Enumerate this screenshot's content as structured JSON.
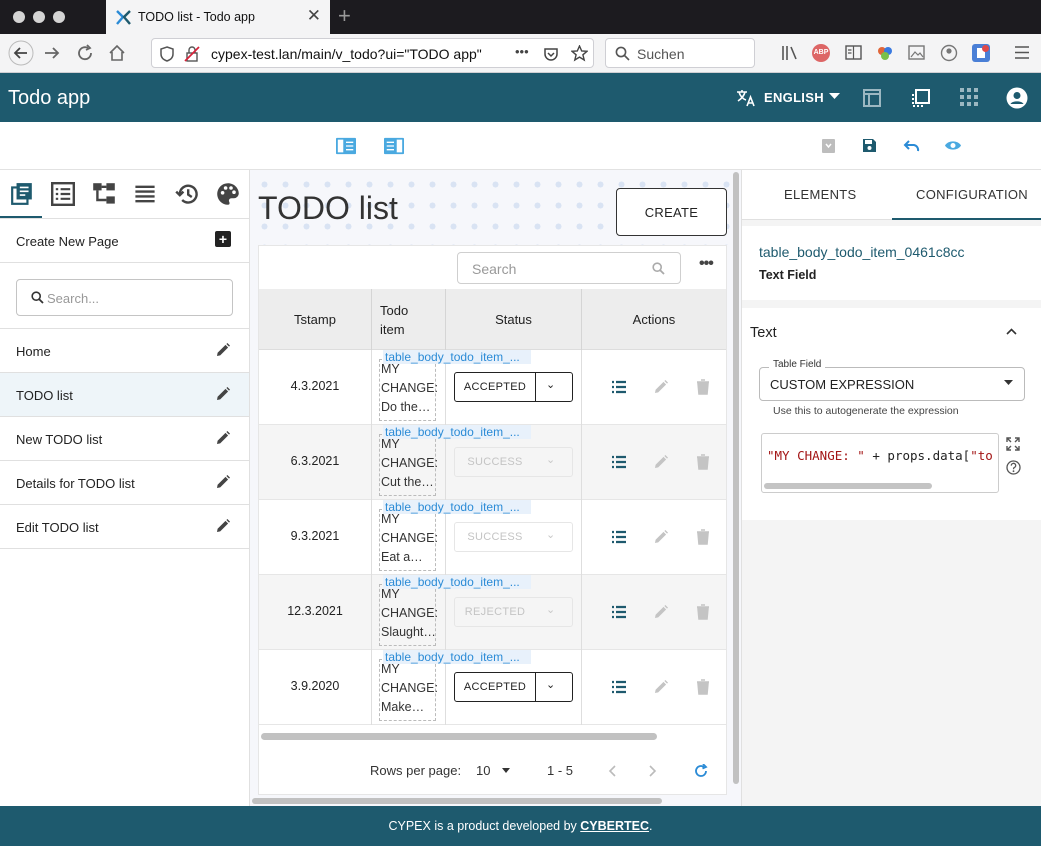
{
  "browser": {
    "tab_title": "TODO list - Todo app",
    "url": "cypex-test.lan/main/v_todo?ui=\"TODO app\"",
    "search_placeholder": "Suchen",
    "url_more": "•••"
  },
  "app": {
    "title": "Todo app",
    "language": "ENGLISH"
  },
  "sidebar": {
    "create_new_page": "Create New Page",
    "search_placeholder": "Search...",
    "pages": [
      {
        "label": "Home"
      },
      {
        "label": "TODO list"
      },
      {
        "label": "New TODO list"
      },
      {
        "label": "Details for TODO list"
      },
      {
        "label": "Edit TODO list"
      }
    ]
  },
  "main": {
    "page_title": "TODO list",
    "create_label": "CREATE",
    "table": {
      "search_placeholder": "Search",
      "columns": [
        "Tstamp",
        "Todo item",
        "Status",
        "Actions"
      ],
      "column_todo_line1": "Todo",
      "column_todo_line2": "item",
      "element_tag": "table_body_todo_item_...",
      "rows": [
        {
          "tstamp": "4.3.2021",
          "todo_l1": "MY",
          "todo_l2": "CHANGE:",
          "todo_l3": "Do the…",
          "status": "ACCEPTED"
        },
        {
          "tstamp": "6.3.2021",
          "todo_l1": "MY",
          "todo_l2": "CHANGE:",
          "todo_l3": "Cut the…",
          "status": "SUCCESS"
        },
        {
          "tstamp": "9.3.2021",
          "todo_l1": "MY",
          "todo_l2": "CHANGE:",
          "todo_l3": "Eat a…",
          "status": "SUCCESS"
        },
        {
          "tstamp": "12.3.2021",
          "todo_l1": "MY",
          "todo_l2": "CHANGE:",
          "todo_l3": "Slaught…",
          "status": "REJECTED"
        },
        {
          "tstamp": "3.9.2020",
          "todo_l1": "MY",
          "todo_l2": "CHANGE:",
          "todo_l3": "Make…",
          "status": "ACCEPTED"
        }
      ],
      "rows_per_page_label": "Rows per page:",
      "rows_per_page": "10",
      "page_range": "1 - 5"
    }
  },
  "right_panel": {
    "tabs": [
      "ELEMENTS",
      "CONFIGURATION"
    ],
    "element_name": "table_body_todo_item_0461c8cc",
    "element_type": "Text Field",
    "section_title": "Text",
    "table_field_label": "Table Field",
    "table_field_value": "CUSTOM EXPRESSION",
    "helper_text": "Use this to autogenerate the expression",
    "code_string": "\"MY CHANGE: \"",
    "code_rest": " + props.data[",
    "code_tail": "\"to"
  },
  "footer": {
    "prefix": "CYPEX is a product developed by ",
    "link": "CYBERTEC",
    "suffix": "."
  },
  "colors": {
    "primary": "#1e5a6e",
    "accent_blue": "#2b8bd6",
    "code_string": "#a31515"
  }
}
